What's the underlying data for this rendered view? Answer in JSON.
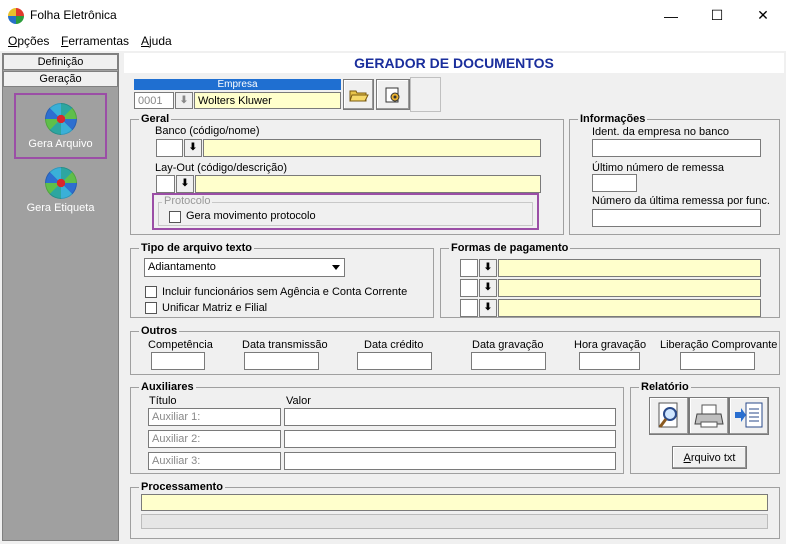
{
  "window": {
    "title": "Folha Eletrônica",
    "minimize": "—",
    "maximize": "☐",
    "close": "✕"
  },
  "menu": {
    "items": [
      {
        "accel": "O",
        "rest": "pções"
      },
      {
        "accel": "F",
        "rest": "erramentas"
      },
      {
        "accel": "A",
        "rest": "juda"
      }
    ]
  },
  "left_pane": {
    "tabs": [
      "Definição",
      "Geração"
    ],
    "items": [
      "Gera Arquivo",
      "Gera Etiqueta"
    ]
  },
  "main": {
    "title": "GERADOR DE DOCUMENTOS",
    "empresa": {
      "header": "Empresa",
      "code": "0001",
      "name": "Wolters Kluwer",
      "lookup_glyph": "⬇"
    },
    "geral": {
      "title": "Geral",
      "banco_label": "Banco (código/nome)",
      "layout_label": "Lay-Out (código/descrição)",
      "protocolo_title": "Protocolo",
      "protocolo_check": "Gera movimento protocolo"
    },
    "informacoes": {
      "title": "Informações",
      "ident_label": "Ident. da empresa no banco",
      "ultimo_label": "Último número de remessa",
      "numero_label": "Número da última remessa por func."
    },
    "tipo_arquivo": {
      "title": "Tipo de arquivo texto",
      "selected": "Adiantamento",
      "check1": "Incluir funcionários sem Agência e Conta Corrente",
      "check2": "Unificar Matriz e Filial"
    },
    "formas_pagamento": {
      "title": "Formas de pagamento"
    },
    "outros": {
      "title": "Outros",
      "labels": [
        "Competência",
        "Data transmissão",
        "Data crédito",
        "Data gravação",
        "Hora gravação",
        "Liberação Comprovante"
      ]
    },
    "auxiliares": {
      "title": "Auxiliares",
      "col_titulo": "Título",
      "col_valor": "Valor",
      "rows": [
        "Auxiliar 1:",
        "Auxiliar 2:",
        "Auxiliar 3:"
      ]
    },
    "relatorio": {
      "title": "Relatório",
      "arquivo_btn": "Arquivo txt",
      "arquivo_accel": "A",
      "arquivo_rest": "rquivo txt"
    },
    "processamento": {
      "title": "Processamento"
    }
  }
}
